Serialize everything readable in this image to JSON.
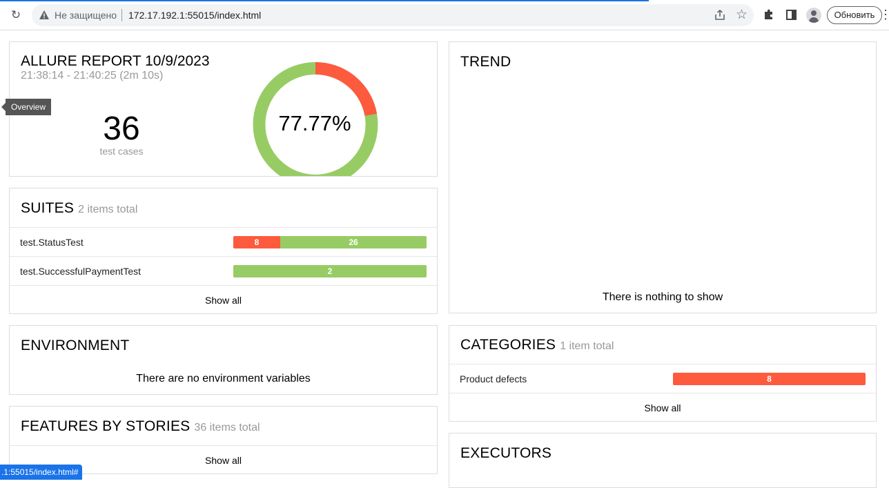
{
  "browser": {
    "insecure_label": "Не защищено",
    "url": "172.17.192.1:55015/index.html",
    "update_button": "Обновить",
    "status_url": ".1:55015/index.html#"
  },
  "tooltip": "Overview",
  "summary": {
    "title": "ALLURE REPORT 10/9/2023",
    "time_range": "21:38:14 - 21:40:25 (2m 10s)",
    "test_cases_count": "36",
    "test_cases_label": "test cases",
    "success_rate": "77.77%",
    "donut_fraction_failed": 0.2223,
    "donut_fraction_passed": 0.7777
  },
  "suites": {
    "title": "SUITES",
    "count_label": "2 items total",
    "items": [
      {
        "name": "test.StatusTest",
        "failed": 8,
        "passed": 26,
        "failed_label": "8",
        "passed_label": "26"
      },
      {
        "name": "test.SuccessfulPaymentTest",
        "failed": 0,
        "passed": 2,
        "passed_label": "2"
      }
    ],
    "show_all": "Show all"
  },
  "environment": {
    "title": "ENVIRONMENT",
    "empty_message": "There are no environment variables"
  },
  "features": {
    "title": "FEATURES BY STORIES",
    "count_label": "36 items total",
    "show_all": "Show all"
  },
  "trend": {
    "title": "TREND",
    "empty_message": "There is nothing to show"
  },
  "categories": {
    "title": "CATEGORIES",
    "count_label": "1 item total",
    "items": [
      {
        "name": "Product defects",
        "failed": 8,
        "failed_label": "8"
      }
    ],
    "show_all": "Show all"
  },
  "executors": {
    "title": "EXECUTORS"
  },
  "colors": {
    "failed": "#fd5a3e",
    "passed": "#97cc64",
    "accent": "#1a73e8"
  }
}
